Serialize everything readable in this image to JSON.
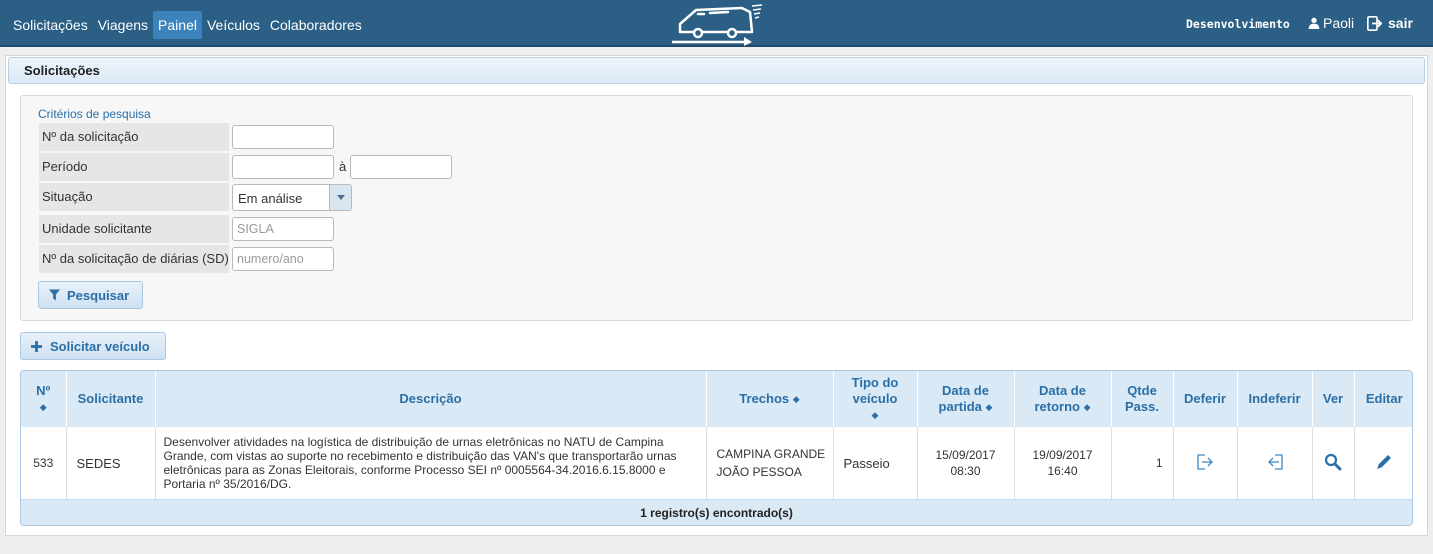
{
  "nav": {
    "items": [
      {
        "label": "Solicitações"
      },
      {
        "label": "Viagens"
      },
      {
        "label": "Painel"
      },
      {
        "label": "Veículos"
      },
      {
        "label": "Colaboradores"
      }
    ],
    "active": "Painel"
  },
  "header": {
    "environment": "Desenvolvimento",
    "user": "Paoli",
    "logout": "sair",
    "logo_icon": "van-icon"
  },
  "page": {
    "title": "Solicitações"
  },
  "filters": {
    "legend": "Critérios de pesquisa",
    "request_number_label": "Nº da solicitação",
    "request_number_value": "",
    "period_label": "Período",
    "period_start": "",
    "period_separator": "à",
    "period_end": "",
    "status_label": "Situação",
    "status_value": "Em análise",
    "unit_label": "Unidade solicitante",
    "unit_placeholder": "SIGLA",
    "sd_label": "Nº da solicitação de diárias (SD)",
    "sd_placeholder": "numero/ano",
    "search_button": "Pesquisar"
  },
  "actions": {
    "request_vehicle": "Solicitar veículo"
  },
  "table": {
    "headers": {
      "number": "Nº",
      "requester": "Solicitante",
      "description": "Descrição",
      "routes": "Trechos",
      "vehicle_type_1": "Tipo do",
      "vehicle_type_2": "veículo",
      "departure_1": "Data de",
      "departure_2": "partida",
      "return_1": "Data de",
      "return_2": "retorno",
      "passengers_1": "Qtde",
      "passengers_2": "Pass.",
      "approve": "Deferir",
      "reject": "Indeferir",
      "view": "Ver",
      "edit": "Editar"
    },
    "rows": [
      {
        "number": "533",
        "requester": "SEDES",
        "description": "Desenvolver atividades na logística de distribuição de urnas eletrônicas no NATU de Campina Grande, com vistas ao suporte no recebimento e distribuição das VAN's que transportarão urnas eletrônicas para as Zonas Eleitorais, conforme Processo SEI nº 0005564-34.2016.6.15.8000 e Portaria nº 35/2016/DG.",
        "route_from": "CAMPINA GRANDE",
        "route_to": "JOÃO PESSOA",
        "vehicle_type": "Passeio",
        "departure_date": "15/09/2017",
        "departure_time": "08:30",
        "return_date": "19/09/2017",
        "return_time": "16:40",
        "passengers": "1"
      }
    ],
    "footer": "1 registro(s) encontrado(s)"
  },
  "colors": {
    "topbar": "#2b5f85",
    "active_nav": "#3c83bb",
    "accent": "#2b6fa6",
    "table_header": "#d9e9f6"
  }
}
